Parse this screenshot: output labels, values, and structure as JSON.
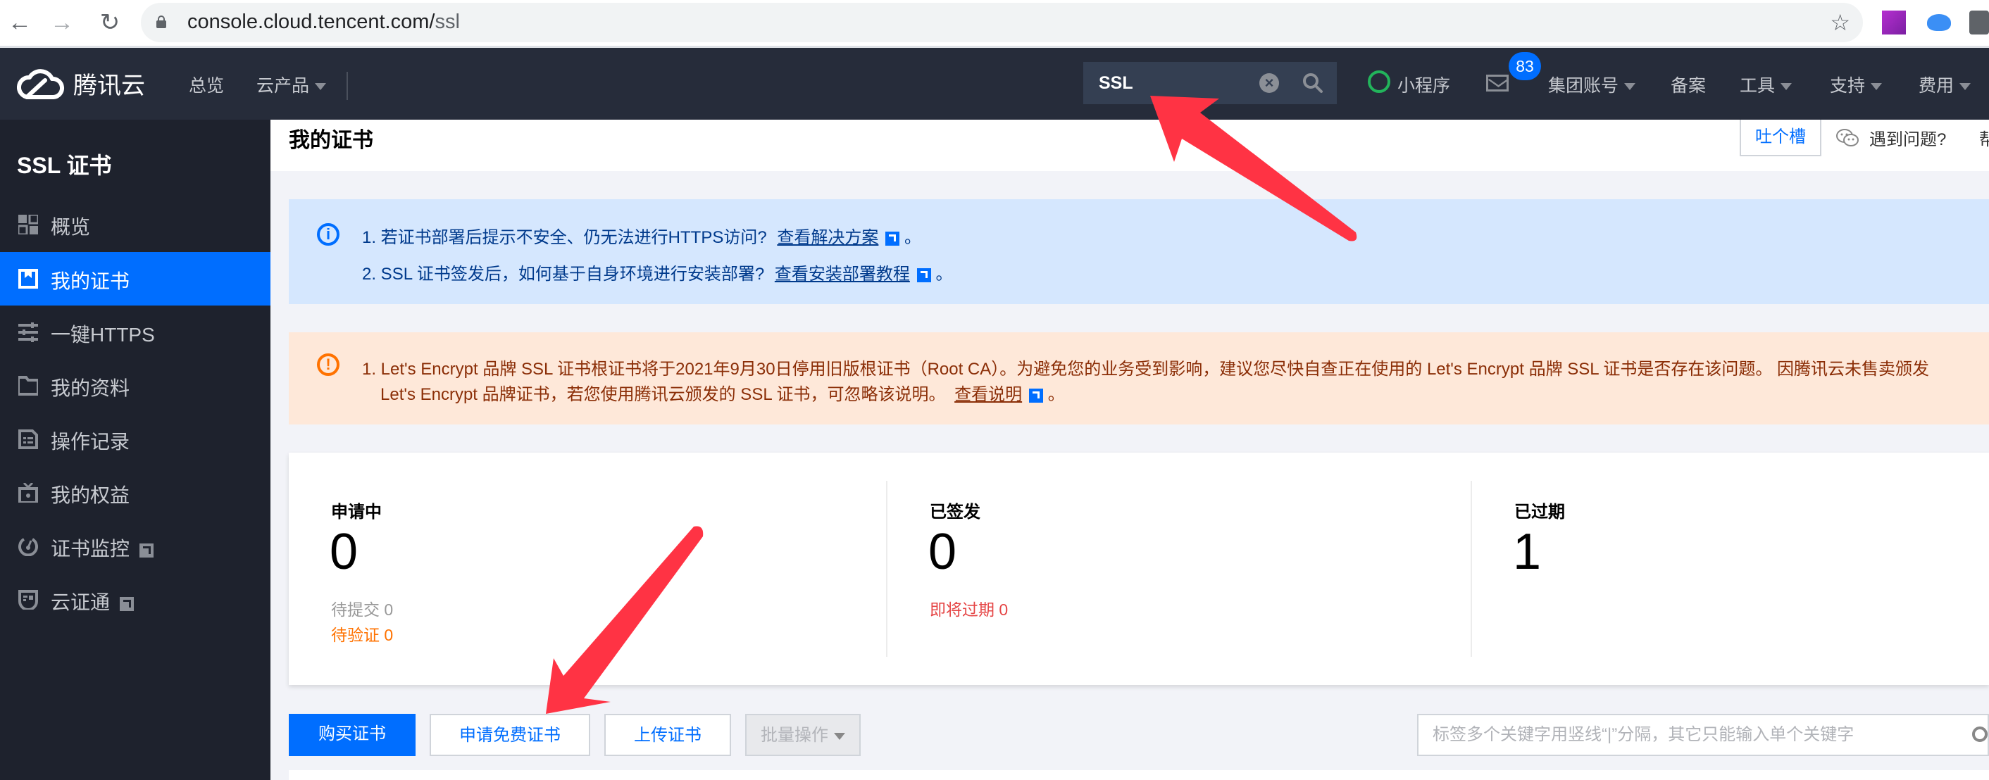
{
  "browser": {
    "url_host": "console.cloud.tencent.com/",
    "url_path": "ssl",
    "icons": [
      "back-icon",
      "forward-icon",
      "reload-icon",
      "lock-icon",
      "star-icon",
      "axure-extension-icon",
      "cloud-extension-icon",
      "puzzle-extension-icon"
    ]
  },
  "topnav": {
    "brand": "腾讯云",
    "links": {
      "overview": "总览",
      "products": "云产品"
    },
    "search": {
      "value": "SSL"
    },
    "miniprogram": "小程序",
    "mail_badge": "83",
    "group_account": "集团账号",
    "filing": "备案",
    "tools": "工具",
    "support": "支持",
    "billing": "费用"
  },
  "sidebar": {
    "title": "SSL 证书",
    "items": [
      {
        "label": "概览",
        "icon": "grid-icon",
        "active": false,
        "external": false
      },
      {
        "label": "我的证书",
        "icon": "certificate-icon",
        "active": true,
        "external": false
      },
      {
        "label": "一键HTTPS",
        "icon": "sliders-icon",
        "active": false,
        "external": false
      },
      {
        "label": "我的资料",
        "icon": "folder-icon",
        "active": false,
        "external": false
      },
      {
        "label": "操作记录",
        "icon": "log-icon",
        "active": false,
        "external": false
      },
      {
        "label": "我的权益",
        "icon": "gift-icon",
        "active": false,
        "external": false
      },
      {
        "label": "证书监控",
        "icon": "monitor-icon",
        "active": false,
        "external": true
      },
      {
        "label": "云证通",
        "icon": "shield-icon",
        "active": false,
        "external": true
      }
    ]
  },
  "header": {
    "title": "我的证书",
    "feedback": "吐个槽",
    "help": "遇到问题?",
    "more": "帮"
  },
  "info_banner": {
    "line1_text": "1. 若证书部署后提示不安全、仍无法进行HTTPS访问?",
    "line1_link": "查看解决方案",
    "line2_text": "2. SSL 证书签发后，如何基于自身环境进行安装部署?",
    "line2_link": "查看安装部署教程",
    "period": "。"
  },
  "warning_banner": {
    "line1_text": "1. Let's Encrypt 品牌 SSL 证书根证书将于2021年9月30日停用旧版根证书（Root CA）。为避免您的业务受到影响，建议您尽快自查正在使用的 Let's Encrypt 品牌 SSL 证书是否存在该问题。 因腾讯云未售卖颁发",
    "line2_text": "Let's Encrypt 品牌证书，若您使用腾讯云颁发的 SSL 证书，可忽略该说明。",
    "line2_link": "查看说明",
    "period": "。"
  },
  "stats": {
    "applying": {
      "title": "申请中",
      "value": "0",
      "pending_submit": "待提交 0",
      "pending_verify": "待验证 0"
    },
    "issued": {
      "title": "已签发",
      "value": "0",
      "expiring": "即将过期 0"
    },
    "expired": {
      "title": "已过期",
      "value": "1"
    }
  },
  "toolbar": {
    "buy": "购买证书",
    "apply_free": "申请免费证书",
    "upload": "上传证书",
    "batch": "批量操作",
    "filter_placeholder": "标签多个关键字用竖线“|”分隔，其它只能输入单个关键字"
  },
  "colors": {
    "primary": "#006eff",
    "nav_bg": "#262c3a",
    "sidebar_bg": "#1e222d",
    "info_bg": "#d5e7fe",
    "warning_bg": "#fee8d9",
    "warning_orange": "#ff7200",
    "danger_red": "#e54545",
    "annotation_arrow": "#ff3344"
  }
}
